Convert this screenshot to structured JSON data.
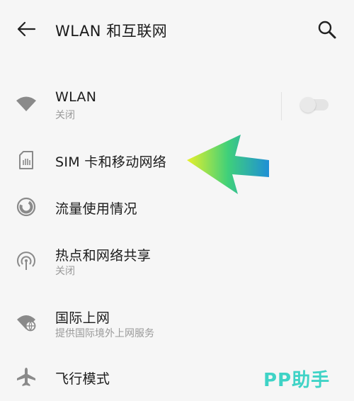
{
  "header": {
    "title": "WLAN 和互联网",
    "back_icon": "arrow-left-icon",
    "search_icon": "search-icon"
  },
  "items": [
    {
      "title": "WLAN",
      "subtitle": "关闭",
      "icon": "wifi-icon",
      "toggle_on": false
    },
    {
      "title": "SIM 卡和移动网络",
      "icon": "sim-card-icon"
    },
    {
      "title": "流量使用情况",
      "icon": "data-usage-icon"
    },
    {
      "title": "热点和网络共享",
      "subtitle": "关闭",
      "icon": "hotspot-icon"
    },
    {
      "title": "国际上网",
      "subtitle": "提供国际境外上网服务",
      "icon": "globe-wifi-icon"
    },
    {
      "title": "飞行模式",
      "icon": "airplane-icon"
    }
  ],
  "watermark": "PP助手",
  "colors": {
    "background": "#f6f6f6",
    "text": "#1c1c1c",
    "subtext": "#9a9a9a",
    "icon": "#8a8a8a",
    "watermark": "#3fd3c6",
    "arrow_start": "#e8f02a",
    "arrow_mid": "#3fd07a",
    "arrow_end": "#1f8fd6"
  }
}
